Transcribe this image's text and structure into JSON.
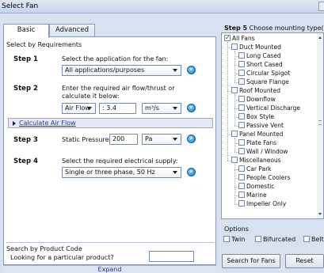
{
  "window": {
    "title": "Select Fan"
  },
  "tabs": [
    {
      "label": "Basic",
      "active": true
    },
    {
      "label": "Advanced",
      "active": false
    }
  ],
  "requirements": {
    "heading": "Select by Requirements",
    "step1": {
      "label": "Step 1",
      "text": "Select the application for the fan:",
      "value": "All applications/purposes"
    },
    "step2": {
      "label": "Step 2",
      "text_line1": "Enter the required air flow/thrust or",
      "text_line2": "calculate it below:",
      "mode": "Air Flow",
      "value": ": 3.4",
      "unit": "m³/s"
    },
    "calc_link": "Calculate Air Flow",
    "step3": {
      "label": "Step 3",
      "text": "Static Pressure:",
      "value": "200",
      "unit": "Pa"
    },
    "step4": {
      "label": "Step 4",
      "text": "Select the required electrical supply:",
      "value": "Single or three phase, 50 Hz"
    }
  },
  "product_code": {
    "heading": "Search by Product Code",
    "prompt": "Looking for a particular product?",
    "value": ""
  },
  "expand_label": "Expand",
  "step5": {
    "label": "Step 5",
    "text": "Choose mounting type(s):",
    "tree": [
      {
        "label": "All Fans",
        "checked": true
      },
      {
        "label": "Duct Mounted",
        "checked": false
      },
      {
        "label": "Long Cased",
        "checked": false
      },
      {
        "label": "Short Cased",
        "checked": false
      },
      {
        "label": "Circular Spigot",
        "checked": false
      },
      {
        "label": "Square Flange",
        "checked": false
      },
      {
        "label": "Roof Mounted",
        "checked": false
      },
      {
        "label": "Downflow",
        "checked": false
      },
      {
        "label": "Vertical Discharge",
        "checked": false
      },
      {
        "label": "Box Style",
        "checked": false
      },
      {
        "label": "Passive Vent",
        "checked": false
      },
      {
        "label": "Panel Mounted",
        "checked": false
      },
      {
        "label": "Plate Fans",
        "checked": false
      },
      {
        "label": "Wall / Window",
        "checked": false
      },
      {
        "label": "Miscellaneous",
        "checked": false
      },
      {
        "label": "Car Park",
        "checked": false
      },
      {
        "label": "People Coolers",
        "checked": false
      },
      {
        "label": "Domestic",
        "checked": false
      },
      {
        "label": "Marine",
        "checked": false
      },
      {
        "label": "Impeller Only",
        "checked": false
      }
    ]
  },
  "options": {
    "heading": "Options",
    "items": [
      {
        "label": "Twin",
        "checked": false
      },
      {
        "label": "Bifurcated",
        "checked": false
      },
      {
        "label": "Belt",
        "checked": false
      }
    ]
  },
  "buttons": {
    "search": "Search for Fans",
    "reset": "Reset"
  }
}
